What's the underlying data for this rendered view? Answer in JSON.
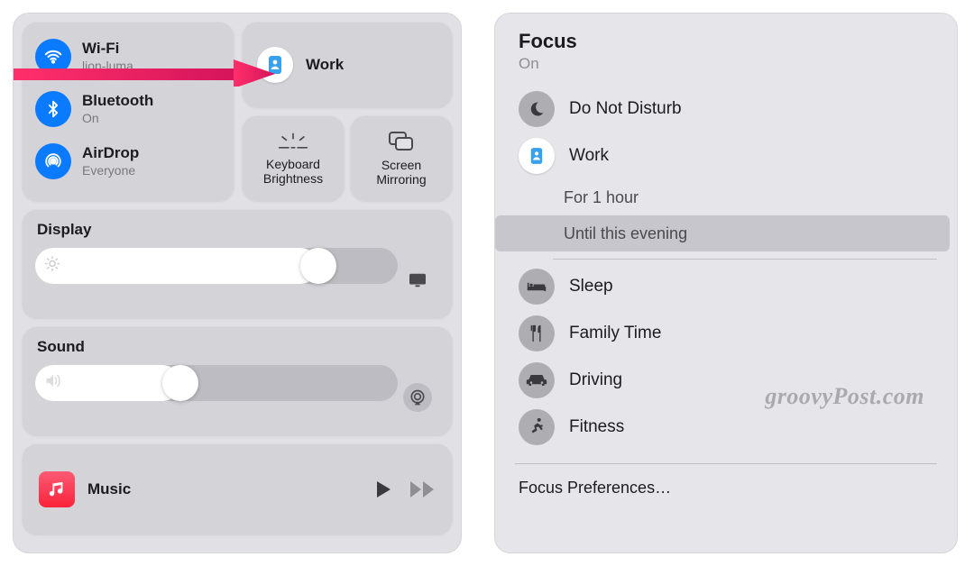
{
  "cc": {
    "wifi": {
      "label": "Wi-Fi",
      "sub": "lion-luma"
    },
    "bluetooth": {
      "label": "Bluetooth",
      "sub": "On"
    },
    "airdrop": {
      "label": "AirDrop",
      "sub": "Everyone"
    },
    "focus": {
      "label": "Work"
    },
    "keyboard_brightness": "Keyboard\nBrightness",
    "screen_mirroring": "Screen\nMirroring",
    "display": {
      "title": "Display",
      "pct": 78
    },
    "sound": {
      "title": "Sound",
      "pct": 40
    },
    "music": {
      "label": "Music"
    }
  },
  "focus": {
    "title": "Focus",
    "subtitle": "On",
    "modes": {
      "dnd": "Do Not Disturb",
      "work": "Work",
      "sleep": "Sleep",
      "family": "Family Time",
      "driving": "Driving",
      "fitness": "Fitness"
    },
    "options": {
      "one_hour": "For 1 hour",
      "evening": "Until this evening"
    },
    "prefs": "Focus Preferences…"
  },
  "watermark": "groovyPost.com"
}
